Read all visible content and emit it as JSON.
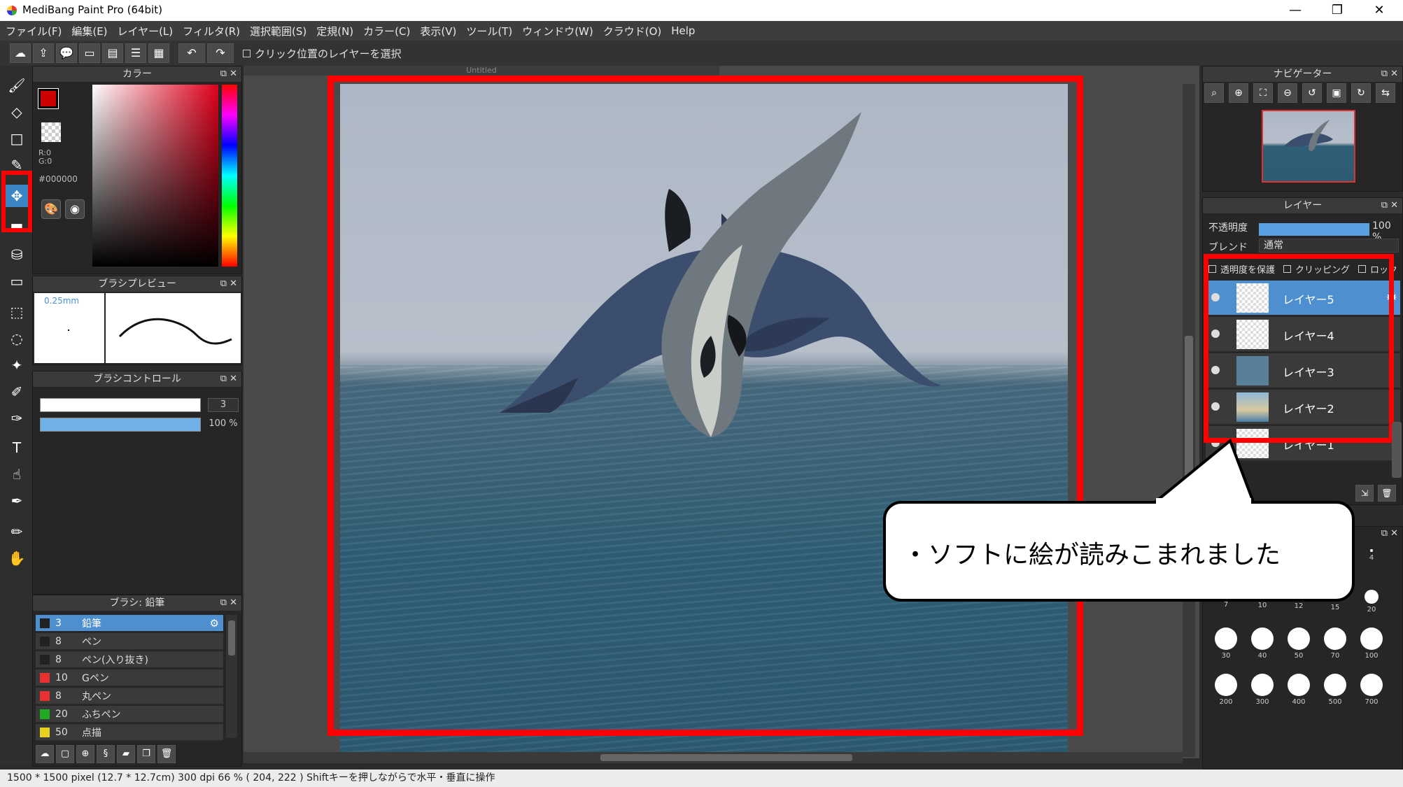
{
  "window": {
    "title": "MediBang Paint Pro (64bit)",
    "minimize": "—",
    "restore": "❐",
    "close": "✕"
  },
  "menu": [
    "ファイル(F)",
    "編集(E)",
    "レイヤー(L)",
    "フィルタ(R)",
    "選択範囲(S)",
    "定規(N)",
    "カラー(C)",
    "表示(V)",
    "ツール(T)",
    "ウィンドウ(W)",
    "クラウド(O)",
    "Help"
  ],
  "toolbar": {
    "select_layer_on_click": "クリック位置のレイヤーを選択"
  },
  "panels": {
    "color": {
      "title": "カラー",
      "r": "R:0",
      "g": "G:0",
      "hex": "#000000",
      "fg_color": "#cc0000",
      "bg_color": "#ffffff"
    },
    "brush_preview": {
      "title": "ブラシプレビュー",
      "size": "0.25mm"
    },
    "brush_control": {
      "title": "ブラシコントロール",
      "size_value": "3",
      "opacity_value": "100 %"
    },
    "brush_list": {
      "title": "ブラシ: 鉛筆",
      "items": [
        {
          "size": "3",
          "name": "鉛筆",
          "color": "#222222",
          "selected": true
        },
        {
          "size": "8",
          "name": "ペン",
          "color": "#222222"
        },
        {
          "size": "8",
          "name": "ペン(入り抜き)",
          "color": "#222222"
        },
        {
          "size": "10",
          "name": "Gペン",
          "color": "#e83030"
        },
        {
          "size": "8",
          "name": "丸ペン",
          "color": "#e83030"
        },
        {
          "size": "20",
          "name": "ふちペン",
          "color": "#22aa22"
        },
        {
          "size": "50",
          "name": "点描",
          "color": "#e8d020"
        }
      ]
    },
    "navigator": {
      "title": "ナビゲーター"
    },
    "layers": {
      "title": "レイヤー",
      "opacity_label": "不透明度",
      "opacity_value": "100 %",
      "blend_label": "ブレンド",
      "blend_value": "通常",
      "protect_alpha": "透明度を保護",
      "clipping": "クリッピング",
      "lock": "ロック",
      "items": [
        {
          "name": "レイヤー5",
          "selected": true
        },
        {
          "name": "レイヤー4"
        },
        {
          "name": "レイヤー3"
        },
        {
          "name": "レイヤー2"
        },
        {
          "name": "レイヤー1"
        }
      ]
    },
    "brush_sizes": {
      "row0": [
        "4"
      ],
      "row1": [
        "7",
        "10",
        "12",
        "15",
        "20"
      ],
      "row2": [
        "30",
        "40",
        "50",
        "70",
        "100"
      ],
      "row3": [
        "200",
        "300",
        "400",
        "500",
        "700"
      ]
    }
  },
  "document": {
    "tab": "Untitled"
  },
  "callout": {
    "text": "・ソフトに絵が読みこまれました"
  },
  "status": {
    "text": "1500 * 1500 pixel   (12.7 * 12.7cm)   300 dpi   66 %   ( 204, 222 )   Shiftキーを押しながらで水平・垂直に操作"
  }
}
